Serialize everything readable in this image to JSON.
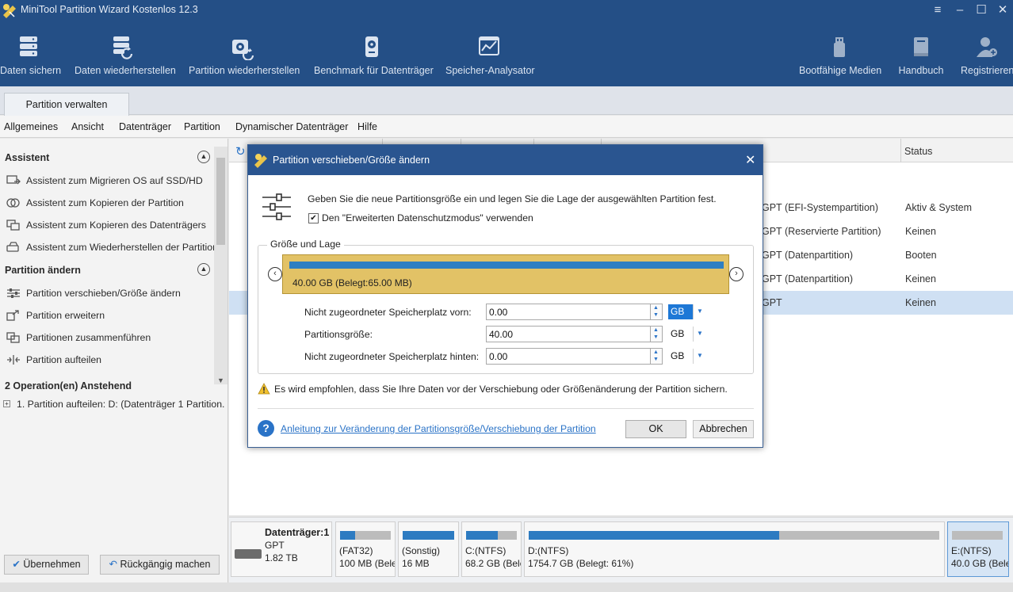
{
  "app": {
    "title": "MiniTool Partition Wizard Kostenlos 12.3",
    "window_controls": [
      "≡",
      "–",
      "☐",
      "✕"
    ]
  },
  "toolbar": [
    {
      "label": "Daten sichern",
      "icon": "database-icon"
    },
    {
      "label": "Daten wiederherstellen",
      "icon": "data-recovery-icon"
    },
    {
      "label": "Partition wiederherstellen",
      "icon": "partition-recovery-icon"
    },
    {
      "label": "Benchmark für Datenträger",
      "icon": "benchmark-icon"
    },
    {
      "label": "Speicher-Analysator",
      "icon": "space-analyzer-icon"
    },
    {
      "label": "Bootfähige Medien",
      "icon": "usb-icon"
    },
    {
      "label": "Handbuch",
      "icon": "book-icon"
    },
    {
      "label": "Registrieren",
      "icon": "register-user-icon"
    }
  ],
  "tab": {
    "label": "Partition verwalten"
  },
  "menu": [
    "Allgemeines",
    "Ansicht",
    "Datenträger",
    "Partition",
    "Dynamischer Datenträger",
    "Hilfe"
  ],
  "left_panel": {
    "section1": {
      "title": "Assistent",
      "items": [
        "Assistent zum Migrieren OS auf SSD/HD",
        "Assistent zum Kopieren der Partition",
        "Assistent zum Kopieren des Datenträgers",
        "Assistent zum Wiederherstellen der Partition"
      ]
    },
    "section2": {
      "title": "Partition ändern",
      "items": [
        "Partition verschieben/Größe ändern",
        "Partition erweitern",
        "Partitionen zusammenführen",
        "Partition aufteilen"
      ]
    },
    "pending": {
      "title": "2 Operation(en) Anstehend",
      "items": [
        "1. Partition aufteilen: D: (Datenträger 1 Partition..."
      ]
    },
    "apply_label": "Übernehmen",
    "undo_label": "Rückgängig machen"
  },
  "grid": {
    "status_header": "Status",
    "rows": [
      {
        "type": "GPT (EFI-Systempartition)",
        "status": "Aktiv & System"
      },
      {
        "type": "GPT (Reservierte Partition)",
        "status": "Keinen"
      },
      {
        "type": "GPT (Datenpartition)",
        "status": "Booten"
      },
      {
        "type": "GPT (Datenpartition)",
        "status": "Keinen"
      },
      {
        "type": "GPT",
        "status": "Keinen"
      }
    ]
  },
  "diskmap": {
    "disk": {
      "name": "Datenträger:1",
      "type": "GPT",
      "size": "1.82 TB"
    },
    "partitions": [
      {
        "l1": "(FAT32)",
        "l2": "100 MB (Bele",
        "used": 0.3
      },
      {
        "l1": "(Sonstig)",
        "l2": "16 MB",
        "used": 1.0
      },
      {
        "l1": "C:(NTFS)",
        "l2": "68.2 GB (Bele",
        "used": 0.62
      },
      {
        "l1": "D:(NTFS)",
        "l2": "1754.7 GB (Belegt: 61%)",
        "used": 0.61
      },
      {
        "l1": "E:(NTFS)",
        "l2": "40.0 GB (Bele",
        "used": 0.0
      }
    ]
  },
  "dialog": {
    "title": "Partition verschieben/Größe ändern",
    "intro": "Geben Sie die neue Partitionsgröße ein und legen Sie die Lage der ausgewählten Partition fest.",
    "checkbox_label": "Den \"Erweiterten Datenschutzmodus\" verwenden",
    "checkbox_checked": true,
    "group_label": "Größe und Lage",
    "partition_bar_text": "40.00 GB (Belegt:65.00 MB)",
    "fields": [
      {
        "label": "Nicht zugeordneter Speicherplatz vorn:",
        "value": "0.00",
        "unit": "GB"
      },
      {
        "label": "Partitionsgröße:",
        "value": "40.00",
        "unit": "GB"
      },
      {
        "label": "Nicht zugeordneter Speicherplatz hinten:",
        "value": "0.00",
        "unit": "GB"
      }
    ],
    "warning": "Es wird empfohlen, dass Sie Ihre Daten vor der Verschiebung oder Größenänderung der Partition sichern.",
    "help_link": "Anleitung zur Veränderung der Partitionsgröße/Verschiebung der Partition",
    "ok_label": "OK",
    "cancel_label": "Abbrechen"
  },
  "colors": {
    "title_blue": "#244f86",
    "dialog_title": "#2a5590",
    "accent": "#2a73c7",
    "partition_yellow": "#e2c266",
    "selected_row": "#cfe0f3"
  }
}
